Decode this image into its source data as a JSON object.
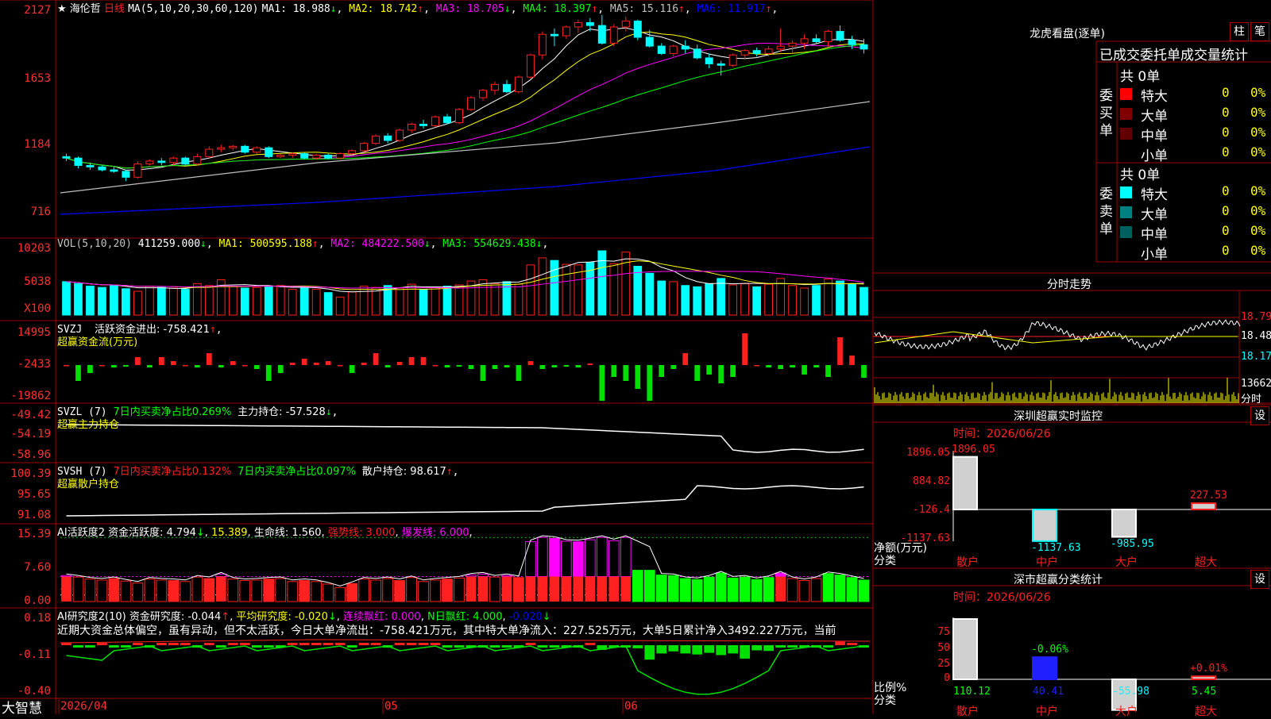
{
  "stock": {
    "name": "海伦哲",
    "period": "日线",
    "star": "★"
  },
  "colors": {
    "up": "#ff2020",
    "down": "#00ffff",
    "ma1": "#ffffff",
    "ma2": "#ffff00",
    "ma3": "#ff00ff",
    "ma4": "#00ff00",
    "ma5": "#c0c0c0",
    "ma6": "#0000ff",
    "grid": "#a00000"
  },
  "price_panel": {
    "legend_prefix": "MA(5,10,20,30,60,120)",
    "ma": [
      {
        "label": "MA1: 18.988",
        "arrow": "↓",
        "color": "#ffffff"
      },
      {
        "label": "MA2: 18.742",
        "arrow": "↑",
        "color": "#ffff00"
      },
      {
        "label": "MA3: 18.705",
        "arrow": "↓",
        "color": "#ff00ff"
      },
      {
        "label": "MA4: 18.397",
        "arrow": "↑",
        "color": "#00ff00"
      },
      {
        "label": "MA5: 15.116",
        "arrow": "↑",
        "color": "#c0c0c0"
      },
      {
        "label": "MA6: 11.917",
        "arrow": "↑",
        "color": "#0000ff"
      }
    ],
    "axis": [
      "2127",
      "1653",
      "1184",
      "716"
    ],
    "high_label": "21.21",
    "low_label": "9.93"
  },
  "chart_data": {
    "type": "candlestick",
    "dates_axis": [
      "2026/04",
      "05",
      "06"
    ],
    "ylim": [
      6.5,
      21.8
    ],
    "candles": [
      [
        11.6,
        11.8,
        11.3,
        11.5
      ],
      [
        11.5,
        11.6,
        10.8,
        11.0
      ],
      [
        11.0,
        11.2,
        10.7,
        10.9
      ],
      [
        10.9,
        11.0,
        10.6,
        10.7
      ],
      [
        10.7,
        10.9,
        10.5,
        10.6
      ],
      [
        10.6,
        10.7,
        9.93,
        10.2
      ],
      [
        10.2,
        11.3,
        10.1,
        11.1
      ],
      [
        11.1,
        11.4,
        11.0,
        11.3
      ],
      [
        11.3,
        11.5,
        11.0,
        11.2
      ],
      [
        11.2,
        11.6,
        11.0,
        11.5
      ],
      [
        11.5,
        11.6,
        11.0,
        11.1
      ],
      [
        11.1,
        11.8,
        11.0,
        11.6
      ],
      [
        11.6,
        12.3,
        11.5,
        12.1
      ],
      [
        12.1,
        12.4,
        11.9,
        12.2
      ],
      [
        12.2,
        12.4,
        12.0,
        12.3
      ],
      [
        12.3,
        12.4,
        11.8,
        11.9
      ],
      [
        11.9,
        12.3,
        11.8,
        12.2
      ],
      [
        12.2,
        12.3,
        11.5,
        11.6
      ],
      [
        11.6,
        11.8,
        11.5,
        11.7
      ],
      [
        11.7,
        11.9,
        11.5,
        11.8
      ],
      [
        11.8,
        11.9,
        11.4,
        11.5
      ],
      [
        11.5,
        11.8,
        11.4,
        11.7
      ],
      [
        11.7,
        11.8,
        11.4,
        11.5
      ],
      [
        11.5,
        11.9,
        11.4,
        11.8
      ],
      [
        11.8,
        12.1,
        11.7,
        12.0
      ],
      [
        12.0,
        12.6,
        11.9,
        12.5
      ],
      [
        12.5,
        13.1,
        12.4,
        13.0
      ],
      [
        13.0,
        13.2,
        12.5,
        12.7
      ],
      [
        12.7,
        13.5,
        12.6,
        13.4
      ],
      [
        13.4,
        13.9,
        13.2,
        13.8
      ],
      [
        13.8,
        14.1,
        13.5,
        13.7
      ],
      [
        13.7,
        14.4,
        13.6,
        14.3
      ],
      [
        14.3,
        14.5,
        13.8,
        13.9
      ],
      [
        13.9,
        14.9,
        13.8,
        14.8
      ],
      [
        14.8,
        15.7,
        14.7,
        15.6
      ],
      [
        15.6,
        16.2,
        15.4,
        16.1
      ],
      [
        16.1,
        16.7,
        15.8,
        16.5
      ],
      [
        16.5,
        16.8,
        15.9,
        16.0
      ],
      [
        16.0,
        17.1,
        15.9,
        17.0
      ],
      [
        17.0,
        18.6,
        16.9,
        18.5
      ],
      [
        18.5,
        20.1,
        18.2,
        19.9
      ],
      [
        19.9,
        20.3,
        19.1,
        19.8
      ],
      [
        19.8,
        20.5,
        19.6,
        20.4
      ],
      [
        20.4,
        20.9,
        20.0,
        20.7
      ],
      [
        20.7,
        21.0,
        20.1,
        20.5
      ],
      [
        20.5,
        21.21,
        19.2,
        19.3
      ],
      [
        19.3,
        20.6,
        19.1,
        20.4
      ],
      [
        20.4,
        21.1,
        20.1,
        20.8
      ],
      [
        20.8,
        20.9,
        19.5,
        19.7
      ],
      [
        19.7,
        20.2,
        19.0,
        19.1
      ],
      [
        19.1,
        19.3,
        18.5,
        18.6
      ],
      [
        18.6,
        19.2,
        18.4,
        19.1
      ],
      [
        19.1,
        19.5,
        18.6,
        18.9
      ],
      [
        18.9,
        19.2,
        18.2,
        18.3
      ],
      [
        18.3,
        18.6,
        17.6,
        17.9
      ],
      [
        17.9,
        18.1,
        17.1,
        17.8
      ],
      [
        17.8,
        18.6,
        17.7,
        18.5
      ],
      [
        18.5,
        18.9,
        18.2,
        18.8
      ],
      [
        18.8,
        19.0,
        18.4,
        18.6
      ],
      [
        18.6,
        19.1,
        18.4,
        18.9
      ],
      [
        18.9,
        20.3,
        18.7,
        19.1
      ],
      [
        19.1,
        19.5,
        18.6,
        19.3
      ],
      [
        19.3,
        19.9,
        18.9,
        19.6
      ],
      [
        19.6,
        19.9,
        19.3,
        19.4
      ],
      [
        19.4,
        20.2,
        19.1,
        20.1
      ],
      [
        20.1,
        20.5,
        19.4,
        19.5
      ],
      [
        19.5,
        19.8,
        18.9,
        19.2
      ],
      [
        19.2,
        19.6,
        18.6,
        18.9
      ]
    ]
  },
  "vol_panel": {
    "legend": [
      {
        "label": "VOL(5,10,20)",
        "color": "#c0c0c0"
      },
      {
        "label": "411259.000",
        "arrow": "↓",
        "color": "#ffffff"
      },
      {
        "label": "MA1: 500595.188",
        "arrow": "↑",
        "color": "#ffff00"
      },
      {
        "label": "MA2: 484222.500",
        "arrow": "↓",
        "color": "#ff00ff"
      },
      {
        "label": "MA3: 554629.438",
        "arrow": "↓",
        "color": "#00ff00"
      }
    ],
    "axis": [
      "10203",
      "5038",
      "X100"
    ],
    "values": [
      5.2,
      4.9,
      4.5,
      4.3,
      4.6,
      4.1,
      3.7,
      4.5,
      4.3,
      4.2,
      4.0,
      4.9,
      4.6,
      5.5,
      4.5,
      4.2,
      4.3,
      4.5,
      4.6,
      4.0,
      4.2,
      4.0,
      3.5,
      2.8,
      3.6,
      4.5,
      4.3,
      4.6,
      4.2,
      4.8,
      4.0,
      4.3,
      4.5,
      4.7,
      5.3,
      5.5,
      4.9,
      5.2,
      4.8,
      7.8,
      8.9,
      8.5,
      7.9,
      7.8,
      8.2,
      10.0,
      8.0,
      9.8,
      7.6,
      6.5,
      5.3,
      5.2,
      4.6,
      4.4,
      4.9,
      5.7,
      4.7,
      4.9,
      4.4,
      4.8,
      5.7,
      4.6,
      4.2,
      4.6,
      5.6,
      5.3,
      4.8,
      4.3
    ]
  },
  "svzj_panel": {
    "title": "SVZJ",
    "label": "活跃资金进出: -758.421",
    "arrow": "↑",
    "sub": "超赢资金流(万元)",
    "axis": [
      "14995",
      "-2433",
      "-19862"
    ],
    "values": [
      0,
      -2,
      -1,
      0,
      -0.3,
      -0.2,
      1,
      -0.3,
      1,
      0.5,
      0,
      -0.3,
      1.5,
      -0.3,
      0.5,
      0,
      -0.5,
      -2,
      -1,
      0.3,
      0.8,
      0.3,
      0.5,
      0,
      -1,
      0.3,
      1.5,
      -0.3,
      0.4,
      1,
      1,
      0,
      -0.3,
      -0.2,
      -0.5,
      -2,
      -0.5,
      -0.3,
      -2,
      0.5,
      -0.5,
      -0.3,
      -0.2,
      -0.3,
      0.2,
      -4.5,
      -1.5,
      -2,
      -3,
      -4.5,
      -1.5,
      -0.5,
      1.5,
      -2,
      -1.2,
      -2.3,
      -1.5,
      4,
      0,
      -0.3,
      -0.5,
      -0.3,
      -1.2,
      -0.3,
      -1.5,
      3.5,
      1.2,
      -1.6
    ]
  },
  "svzl_panel": {
    "title": "SVZL (7)",
    "t1": "7日内买卖净占比0.269%",
    "t2": "主力持仓: -57.528",
    "arrow": "↓",
    "sub": "超赢主力持仓",
    "axis": [
      "-49.42",
      "-54.19",
      "-58.96"
    ]
  },
  "svsh_panel": {
    "title": "SVSH (7)",
    "t1": "7日内买卖净占比0.132%",
    "t2": "7日内买卖净占比0.097%",
    "t3": "散户持仓: 98.617",
    "arrow": "↑",
    "sub": "超赢散户持仓",
    "axis": [
      "100.39",
      "95.65",
      "91.08"
    ]
  },
  "ai1_panel": {
    "title": "AI活跃度2",
    "t1": "资金活跃度: 4.794",
    "a1": "↓",
    "t2": "15.389",
    "t3": "生命线: 1.560",
    "t4": "强势线: 3.000",
    "t5": "爆发线: 6.000",
    "axis": [
      "15.39",
      "7.60",
      "0.00"
    ]
  },
  "ai2_panel": {
    "title": "AI研究度2(10)",
    "t1": "资金研究度: -0.044",
    "t2": "平均研究度: -0.020",
    "t3": "连续飘红: 0.000",
    "t4": "N日飘红: 4.000",
    "t5": "-0.020",
    "comment": "近期大资金总体偏空，虽有异动，但不太活跃，今日大单净流出：-758.421万元，其中特大单净流入：227.525万元，大单5日累计净入3492.227万元，当前",
    "axis": [
      "0.18",
      "-0.11",
      "-0.40"
    ]
  },
  "footer": {
    "brand": "大智慧"
  },
  "right": {
    "lhb": {
      "title": "龙虎看盘(逐单)",
      "btn1": "柱",
      "btn2": "笔",
      "header": "已成交委托单成交量统计",
      "buy": {
        "vlabel": "委买单",
        "total": "共 0单",
        "rows": [
          {
            "name": "特大",
            "v": "0",
            "p": "0%",
            "c": "#ff0000"
          },
          {
            "name": "大单",
            "v": "0",
            "p": "0%",
            "c": "#800000"
          },
          {
            "name": "中单",
            "v": "0",
            "p": "0%",
            "c": "#600000"
          },
          {
            "name": "小单",
            "v": "0",
            "p": "0%",
            "c": ""
          }
        ]
      },
      "sell": {
        "vlabel": "委卖单",
        "total": "共 0单",
        "rows": [
          {
            "name": "特大",
            "v": "0",
            "p": "0%",
            "c": "#00ffff"
          },
          {
            "name": "大单",
            "v": "0",
            "p": "0%",
            "c": "#008080"
          },
          {
            "name": "中单",
            "v": "0",
            "p": "0%",
            "c": "#006060"
          },
          {
            "name": "小单",
            "v": "0",
            "p": "0%",
            "c": ""
          }
        ]
      }
    },
    "fs": {
      "title": "分时走势",
      "axis": [
        "18.79",
        "18.48",
        "18.17"
      ],
      "vol": "13662",
      "vol_unit": "分时"
    },
    "sz_monitor": {
      "title": "深圳超赢实时监控",
      "btn": "设",
      "time": "时间：2026/06/26",
      "axis": [
        "1896.05",
        "884.82",
        "-126.4",
        "-1137.63"
      ],
      "ylabel1": "净额(万元)",
      "ylabel2": "分类",
      "bars": [
        {
          "cat": "散户",
          "value": 1896.05,
          "label": "1896.05"
        },
        {
          "cat": "中户",
          "value": -1137.63,
          "label": "-1137.63"
        },
        {
          "cat": "大户",
          "value": -985.95,
          "label": "-985.95"
        },
        {
          "cat": "超大",
          "value": 227.53,
          "label": "227.53"
        }
      ]
    },
    "sh_stat": {
      "title": "深市超赢分类统计",
      "btn": "设",
      "time": "时间：2026/06/26",
      "axis": [
        "75",
        "50",
        "25",
        "0"
      ],
      "ylabel1": "比例%",
      "ylabel2": "分类",
      "bars": [
        {
          "cat": "散户",
          "value": 110.12,
          "label": "110.12",
          "pct": ""
        },
        {
          "cat": "中户",
          "value": 40.41,
          "label": "40.41",
          "pct": "-0.06%"
        },
        {
          "cat": "大户",
          "value": -55.98,
          "label": "-55.98",
          "pct": ""
        },
        {
          "cat": "超大",
          "value": 5.45,
          "label": "5.45",
          "pct": "+0.01%"
        }
      ]
    }
  }
}
